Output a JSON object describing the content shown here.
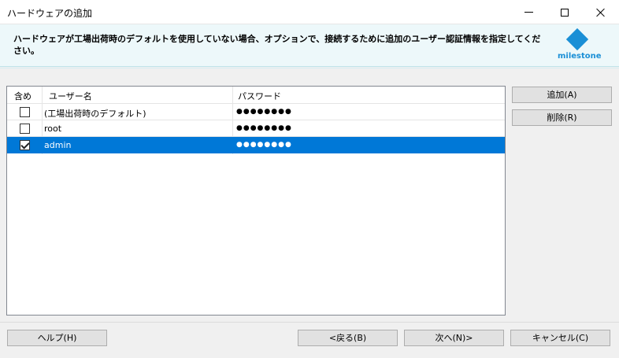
{
  "window": {
    "title": "ハードウェアの追加",
    "minimize_icon": "minimize-icon",
    "maximize_icon": "maximize-icon",
    "close_icon": "close-icon"
  },
  "header": {
    "instruction": "ハードウェアが工場出荷時のデフォルトを使用していない場合、オプションで、接続するために追加のユーザー認証情報を指定してください。",
    "logo_text": "milestone",
    "logo_color": "#1a8fd6"
  },
  "grid": {
    "columns": [
      "含め",
      "ユーザー名",
      "パスワード"
    ],
    "rows": [
      {
        "include": false,
        "username": "(工場出荷時のデフォルト)",
        "password": "●●●●●●●●",
        "selected": false
      },
      {
        "include": false,
        "username": "root",
        "password": "●●●●●●●●",
        "selected": false
      },
      {
        "include": true,
        "username": "admin",
        "password": "●●●●●●●●",
        "selected": true
      }
    ],
    "selection_color": "#0078d7"
  },
  "side_buttons": {
    "add": "追加(A)",
    "remove": "削除(R)"
  },
  "footer": {
    "help": "ヘルプ(H)",
    "back": "<戻る(B)",
    "next": "次へ(N)>",
    "cancel": "キャンセル(C)"
  }
}
